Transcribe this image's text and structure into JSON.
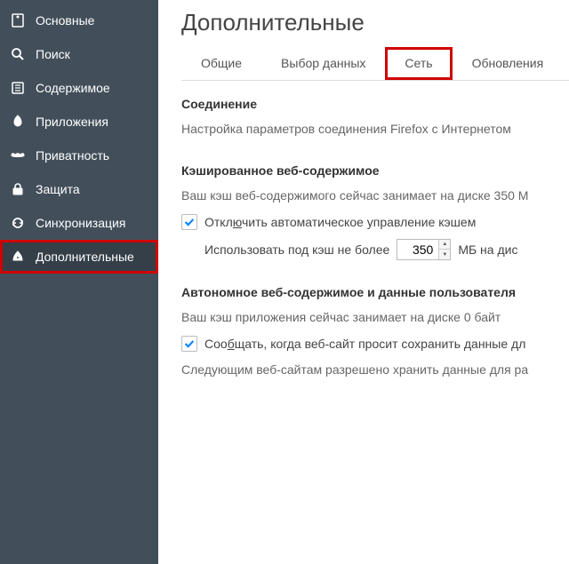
{
  "sidebar": {
    "items": [
      {
        "label": "Основные"
      },
      {
        "label": "Поиск"
      },
      {
        "label": "Содержимое"
      },
      {
        "label": "Приложения"
      },
      {
        "label": "Приватность"
      },
      {
        "label": "Защита"
      },
      {
        "label": "Синхронизация"
      },
      {
        "label": "Дополнительные"
      }
    ]
  },
  "page": {
    "title": "Дополнительные"
  },
  "tabs": {
    "general": "Общие",
    "data": "Выбор данных",
    "network": "Сеть",
    "updates": "Обновления"
  },
  "connection": {
    "heading": "Соединение",
    "text": "Настройка параметров соединения Firefox с Интернетом"
  },
  "cache": {
    "heading": "Кэшированное веб-содержимое",
    "status": "Ваш кэш веб-содержимого сейчас занимает на диске 350 М",
    "override_label_pre": "Откл",
    "override_label_u": "ю",
    "override_label_post": "чить автоматическое управление кэшем",
    "limit_label": "Использовать под кэш не более",
    "limit_value": "350",
    "limit_unit": "МБ на дис"
  },
  "offline": {
    "heading": "Автономное веб-содержимое и данные пользователя",
    "status": "Ваш кэш приложения сейчас занимает на диске 0 байт",
    "notify_label_pre": "Соо",
    "notify_label_u": "б",
    "notify_label_post": "щать, когда веб-сайт просит сохранить данные дл",
    "allow_text": "Следующим веб-сайтам разрешено хранить данные для ра"
  }
}
